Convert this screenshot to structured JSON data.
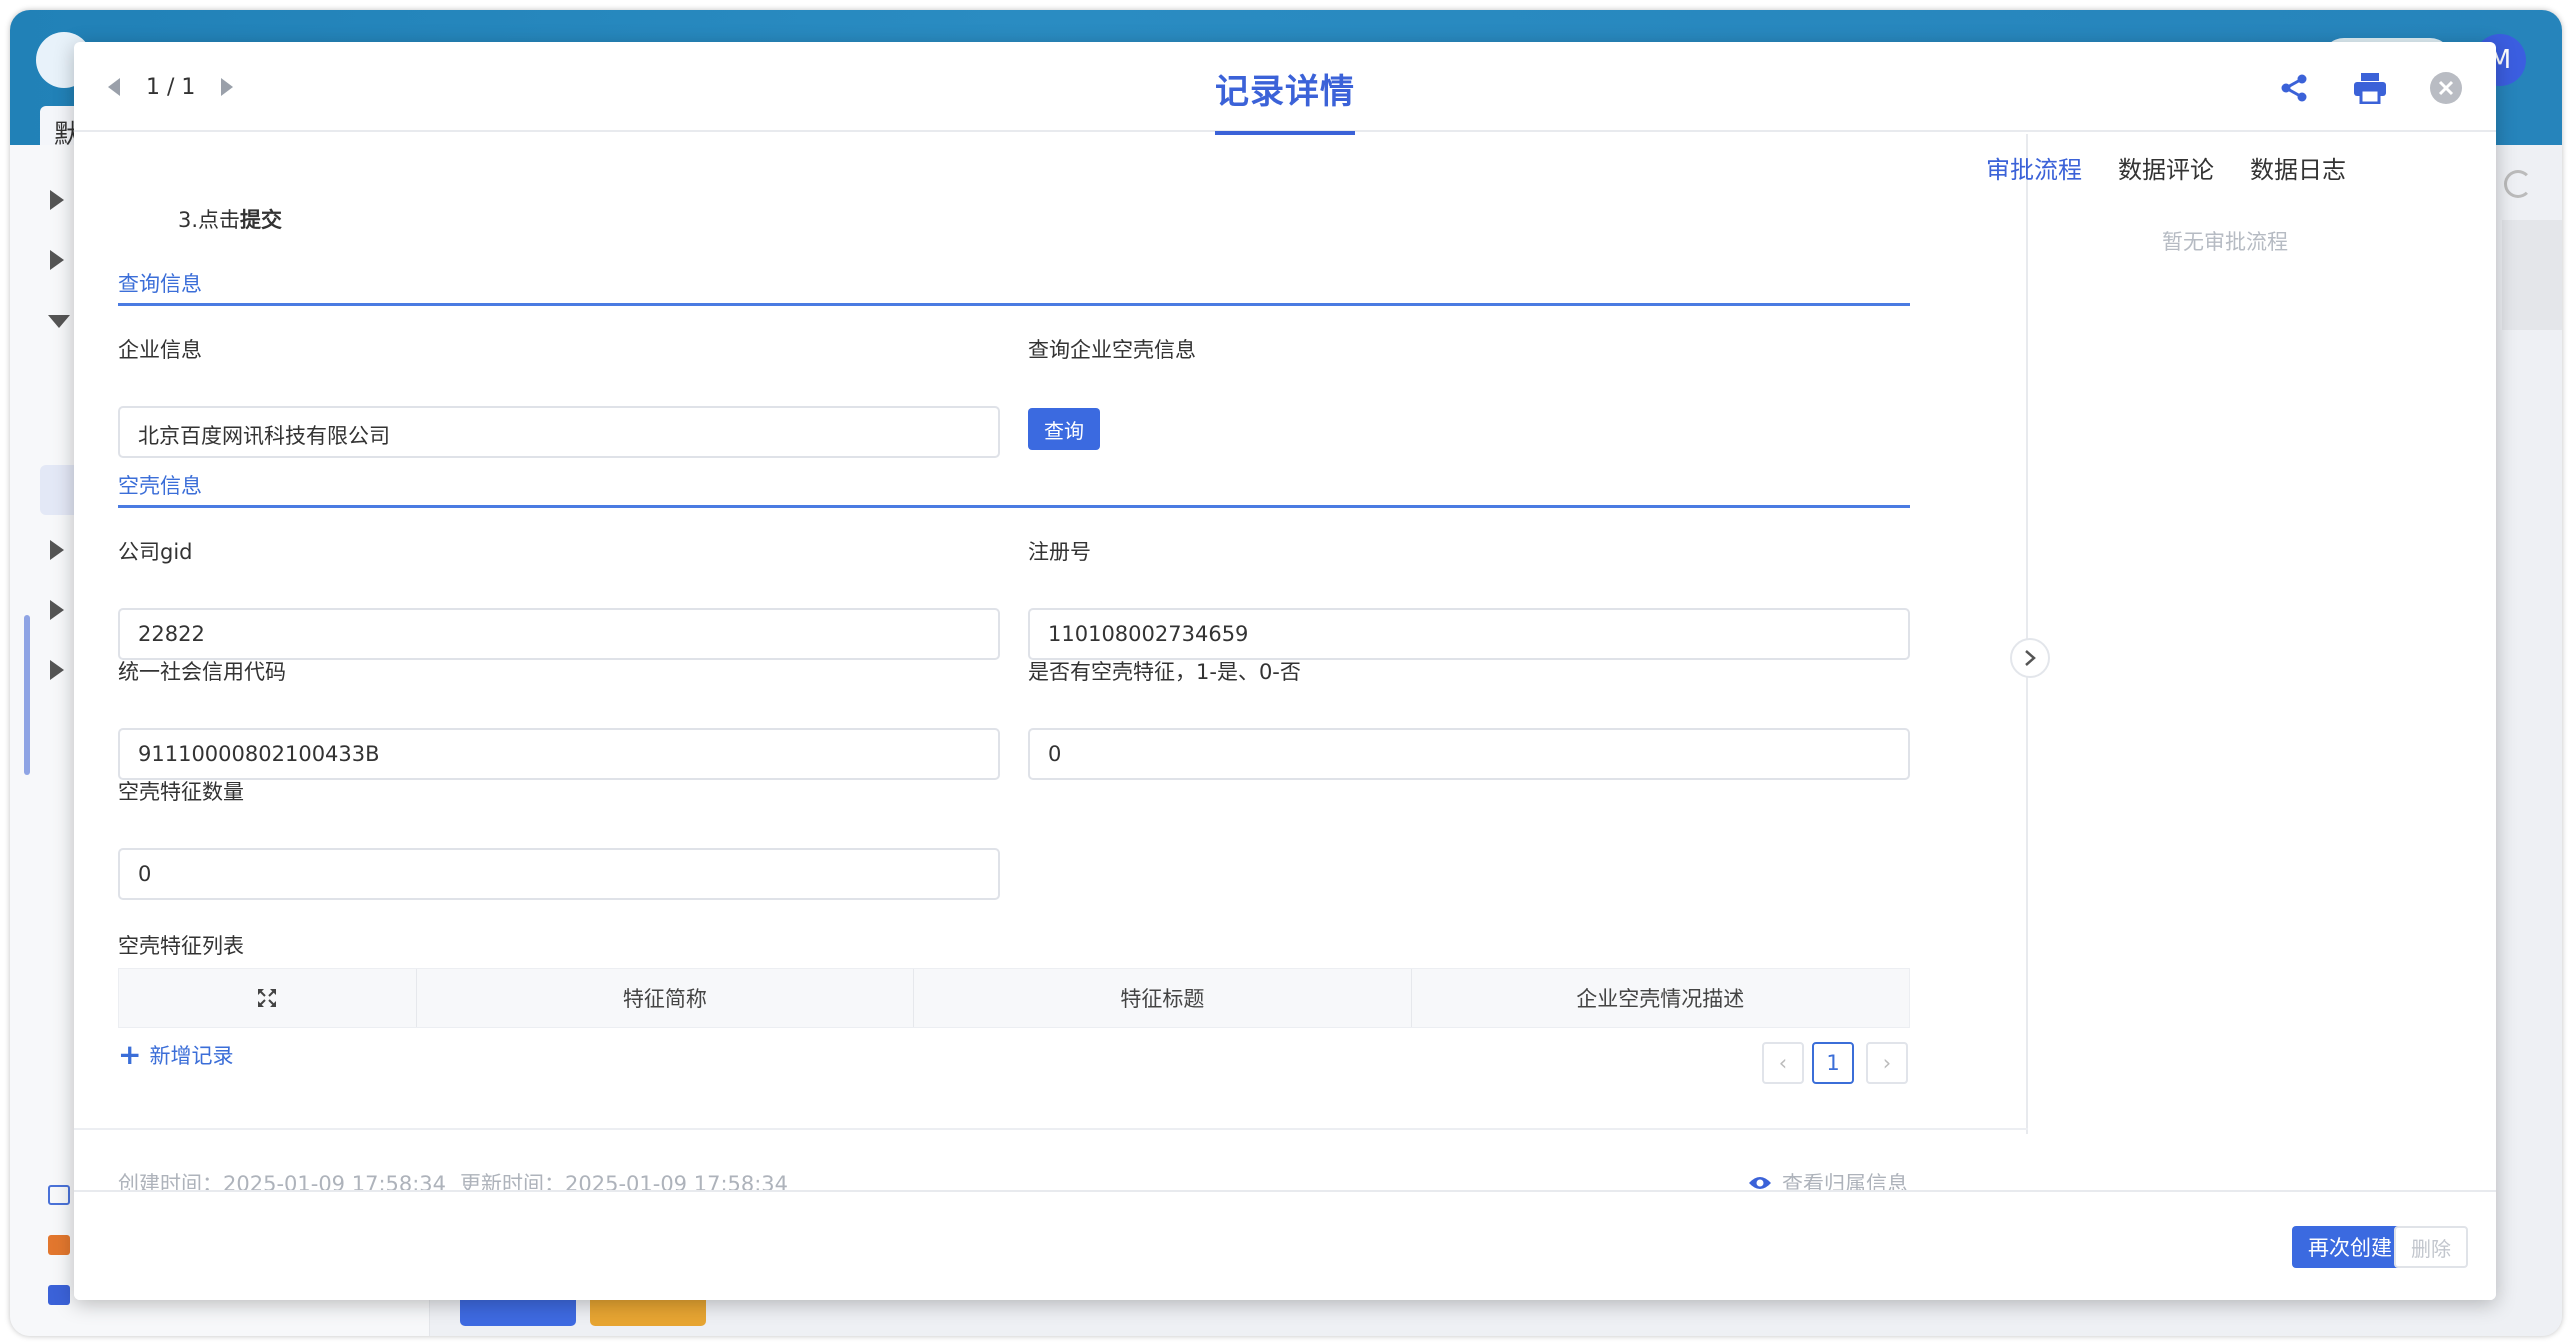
{
  "background": {
    "tab_fragment": "默",
    "avatar_letter": "M"
  },
  "modal": {
    "pager": "1 / 1",
    "title": "记录详情"
  },
  "form": {
    "step_prefix": "3.点击",
    "step_bold": "提交",
    "section_query": "查询信息",
    "enterprise_label": "企业信息",
    "enterprise_value": "北京百度网讯科技有限公司",
    "query_label": "查询企业空壳信息",
    "query_button": "查询",
    "section_shell": "空壳信息",
    "gid_label": "公司gid",
    "gid_value": "22822",
    "reg_label": "注册号",
    "reg_value": "110108002734659",
    "credit_label": "统一社会信用代码",
    "credit_value": "91110000802100433B",
    "has_shell_label": "是否有空壳特征，1-是、0-否",
    "has_shell_value": "0",
    "count_label": "空壳特征数量",
    "count_value": "0",
    "list_label": "空壳特征列表",
    "columns": [
      "特征简称",
      "特征标题",
      "企业空壳情况描述"
    ],
    "add_record": "新增记录",
    "current_page": "1"
  },
  "meta": {
    "created": "创建时间：2025-01-09 17:58:34",
    "updated": "更新时间：2025-01-09 17:58:34",
    "view_owner": "查看归属信息"
  },
  "side": {
    "tabs": [
      "审批流程",
      "数据评论",
      "数据日志"
    ],
    "empty": "暂无审批流程"
  },
  "actions": {
    "recreate": "再次创建",
    "delete": "删除"
  },
  "colors": {
    "accent": "#3b62d8",
    "primary_button": "#3b6ae0",
    "header_bg": "#2181b7"
  }
}
